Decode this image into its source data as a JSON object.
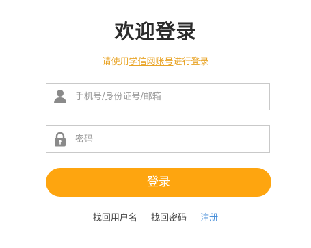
{
  "page": {
    "title": "欢迎登录",
    "subtitle": {
      "before": "请使用",
      "link": "学信网账号",
      "after": "进行登录"
    }
  },
  "form": {
    "username_placeholder": "手机号/身份证号/邮箱",
    "username_value": "",
    "password_placeholder": "密码",
    "password_value": "",
    "submit_label": "登录"
  },
  "links": {
    "find_username": "找回用户名",
    "find_password": "找回密码",
    "register": "注册"
  },
  "icons": {
    "username": "user-icon",
    "password": "lock-icon"
  },
  "colors": {
    "accent": "#fea50f",
    "subtitle": "#e8a325",
    "link_blue": "#3a86d6",
    "title": "#2b2b2b",
    "icon": "#8a8a8a"
  }
}
